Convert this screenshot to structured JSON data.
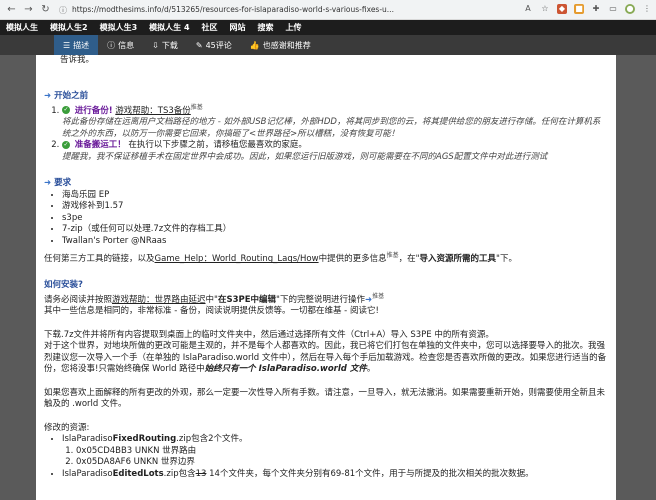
{
  "browser": {
    "url": "https://modthesims.info/d/513265/resources-for-islaparadiso-world-s-various-fixes-u..."
  },
  "topnav": [
    "模拟人生",
    "模拟人生2",
    "模拟人生3",
    "模拟人生 4",
    "社区",
    "网站",
    "搜索",
    "上传"
  ],
  "tabs": [
    {
      "icon": "menu-icon",
      "label": "描述"
    },
    {
      "icon": "info-icon",
      "label": "信息"
    },
    {
      "icon": "download-icon",
      "label": "下载"
    },
    {
      "icon": "comment-icon",
      "label": "45评论"
    },
    {
      "icon": "thumbs-up-icon",
      "label": "也感谢和推荐"
    }
  ],
  "content": {
    "top_line": "告诉我。",
    "before": {
      "heading": "开始之前",
      "step1_title": "进行备份!",
      "step1_link": "游戏帮助：TS3备份",
      "step1_sup": "推基",
      "step1_note": "将此备份存储在远离用户文档路径的地方 - 如外部USB记忆棒，外部HDD，将其同步到您的云，将其提供给您的朋友进行存储。任何在计算机系统之外的东西，以防万一你需要它回来，你搞砸了<世界路径>所以槽糕，没有恢复可能！",
      "step2_title": "准备搬运工！",
      "step2_text": "在执行以下步骤之前，请移植您最喜欢的家庭。",
      "step2_note": "提醒我，我不保证移植手术在固定世界中会成功。因此，如果您运行旧版游戏，则可能需要在不同的AGS配置文件中对此进行测试"
    },
    "req": {
      "heading": "要求",
      "items": [
        "海岛乐园 EP",
        "游戏修补到1.57",
        "s3pe",
        "7-zip（或任何可以处理.7z文件的存档工具）",
        "Twallan's Porter @NRaas"
      ],
      "tools_pre": "任何第三方工具的链接，以及",
      "tools_link": "Game_Help：World_Routing_Lags/How",
      "tools_mid": "中提供的更多信息",
      "tools_sup": "推基",
      "tools_bold": "导入资源所需的工具",
      "tools_post": "下。"
    },
    "install": {
      "heading": "如何安装?",
      "line1_pre": "请务必阅读并按照",
      "line1_link": "游戏帮助：世界路由延迟",
      "line1_mid": "中",
      "line1_bold": "在S3PE中编辑",
      "line1_post": "下的完整说明进行操作",
      "line1_sup": "推基",
      "line2": "其中一些信息是相同的，非常标准 - 备份，阅读说明提供反馈等。一切都在维基 - 阅读它!",
      "para1": "下载.7z文件并将所有内容提取到桌面上的临时文件夹中，然后通过选择所有文件（Ctrl+A）导入 S3PE 中的所有资源。",
      "para2_a": "对于这个世界，对地块所做的更改可能是主观的，并不是每个人都喜欢的。因此，我已将它们打包在单独的文件夹中，您可以选择要导入的批次。我强烈建议您一次导入一个手（在单独的 IslaParadiso.world 文件中），然后在导入每个手后加载游戏。检查您是否喜欢所做的更改。如果您进行适当的备份，您将没事!只需始终确保 World 路径中",
      "para2_b": "始终只有一个 IslaParadiso.world 文件",
      "para3": "如果您喜欢上面解释的所有更改的外观，那么一定要一次性导入所有手数。请注意，一旦导入，就无法撤消。如果需要重新开始，则需要使用全新且未触及的 .world 文件。",
      "res_heading": "修改的资源:",
      "res1_pre": "IslaParadiso",
      "res1_bold": "FixedRouting",
      "res1_post": ".zip包含2个文件。",
      "res1_items": [
        "0x05CD4BB3 UNKN 世界路由",
        "0x05DA8AF6 UNKN 世界边界"
      ],
      "res2_pre": "IslaParadiso",
      "res2_bold": "EditedLots",
      "res2_mid": ".zip包含",
      "res2_strike": "13",
      "res2_post": " 14个文件夹，每个文件夹分别有69-81个文件，用于与所提及的批次相关的批次数据。"
    }
  }
}
